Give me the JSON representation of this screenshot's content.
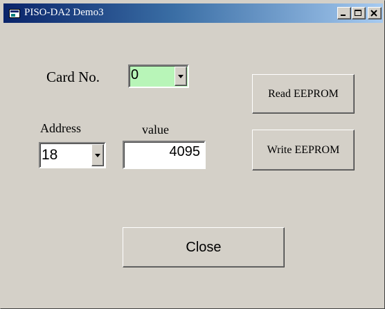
{
  "window": {
    "title": "PISO-DA2 Demo3",
    "background": "#d4d0c8",
    "titlebar_gradient": [
      "#0a246a",
      "#a6caf0"
    ]
  },
  "titlebar_buttons": {
    "minimize_icon": "minimize-icon",
    "maximize_icon": "maximize-icon",
    "close_icon": "close-icon"
  },
  "card": {
    "label": "Card No.",
    "selected": "0",
    "highlight_color": "#b8f5b8"
  },
  "address": {
    "label": "Address",
    "selected": "18"
  },
  "value": {
    "label": "value",
    "current": "4095"
  },
  "buttons": {
    "read_eeprom": "Read EEPROM",
    "write_eeprom": "Write EEPROM",
    "close": "Close"
  }
}
